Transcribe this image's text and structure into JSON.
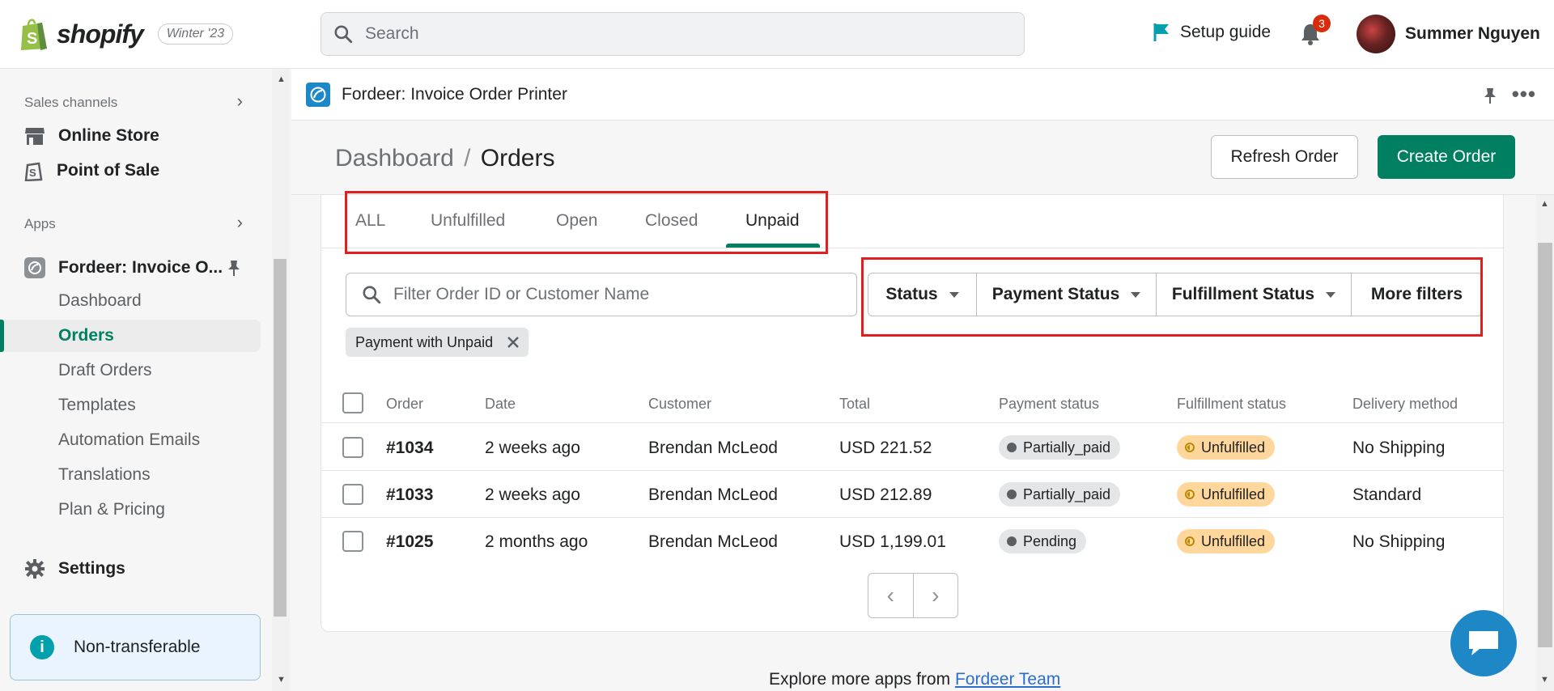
{
  "topbar": {
    "brand": "shopify",
    "edition": "Winter '23",
    "search_placeholder": "Search",
    "setup_guide": "Setup guide",
    "notification_count": "3",
    "user_name": "Summer Nguyen"
  },
  "sidebar": {
    "sales_channels_label": "Sales channels",
    "online_store": "Online Store",
    "point_of_sale": "Point of Sale",
    "apps_label": "Apps",
    "app_name": "Fordeer: Invoice O...",
    "sub_items": [
      "Dashboard",
      "Orders",
      "Draft Orders",
      "Templates",
      "Automation Emails",
      "Translations",
      "Plan & Pricing"
    ],
    "active_item": "Orders",
    "settings": "Settings",
    "non_transferable": "Non-transferable"
  },
  "appbar": {
    "title": "Fordeer: Invoice Order Printer"
  },
  "page": {
    "breadcrumb_parent": "Dashboard",
    "breadcrumb_sep": "/",
    "breadcrumb_current": "Orders",
    "refresh_button": "Refresh Order",
    "create_button": "Create Order"
  },
  "tabs": [
    "ALL",
    "Unfulfilled",
    "Open",
    "Closed",
    "Unpaid"
  ],
  "active_tab": "Unpaid",
  "filters": {
    "input_placeholder": "Filter Order ID or Customer Name",
    "status": "Status",
    "payment_status": "Payment Status",
    "fulfillment_status": "Fulfillment Status",
    "more_filters": "More filters",
    "applied_chip": "Payment with Unpaid"
  },
  "table": {
    "headers": [
      "Order",
      "Date",
      "Customer",
      "Total",
      "Payment status",
      "Fulfillment status",
      "Delivery method"
    ],
    "rows": [
      {
        "order": "#1034",
        "date": "2 weeks ago",
        "customer": "Brendan McLeod",
        "total": "USD 221.52",
        "payment": "Partially_paid",
        "fulfillment": "Unfulfilled",
        "delivery": "No Shipping"
      },
      {
        "order": "#1033",
        "date": "2 weeks ago",
        "customer": "Brendan McLeod",
        "total": "USD 212.89",
        "payment": "Partially_paid",
        "fulfillment": "Unfulfilled",
        "delivery": "Standard"
      },
      {
        "order": "#1025",
        "date": "2 months ago",
        "customer": "Brendan McLeod",
        "total": "USD 1,199.01",
        "payment": "Pending",
        "fulfillment": "Unfulfilled",
        "delivery": "No Shipping"
      }
    ]
  },
  "footer": {
    "explore_text": "Explore more apps from",
    "explore_link": "Fordeer Team"
  },
  "colors": {
    "accent": "#008060",
    "link": "#2c6ecb",
    "badge_red": "#d82c0d",
    "fulfillment_pill": "#ffd79d",
    "highlight_box": "#e02020"
  }
}
